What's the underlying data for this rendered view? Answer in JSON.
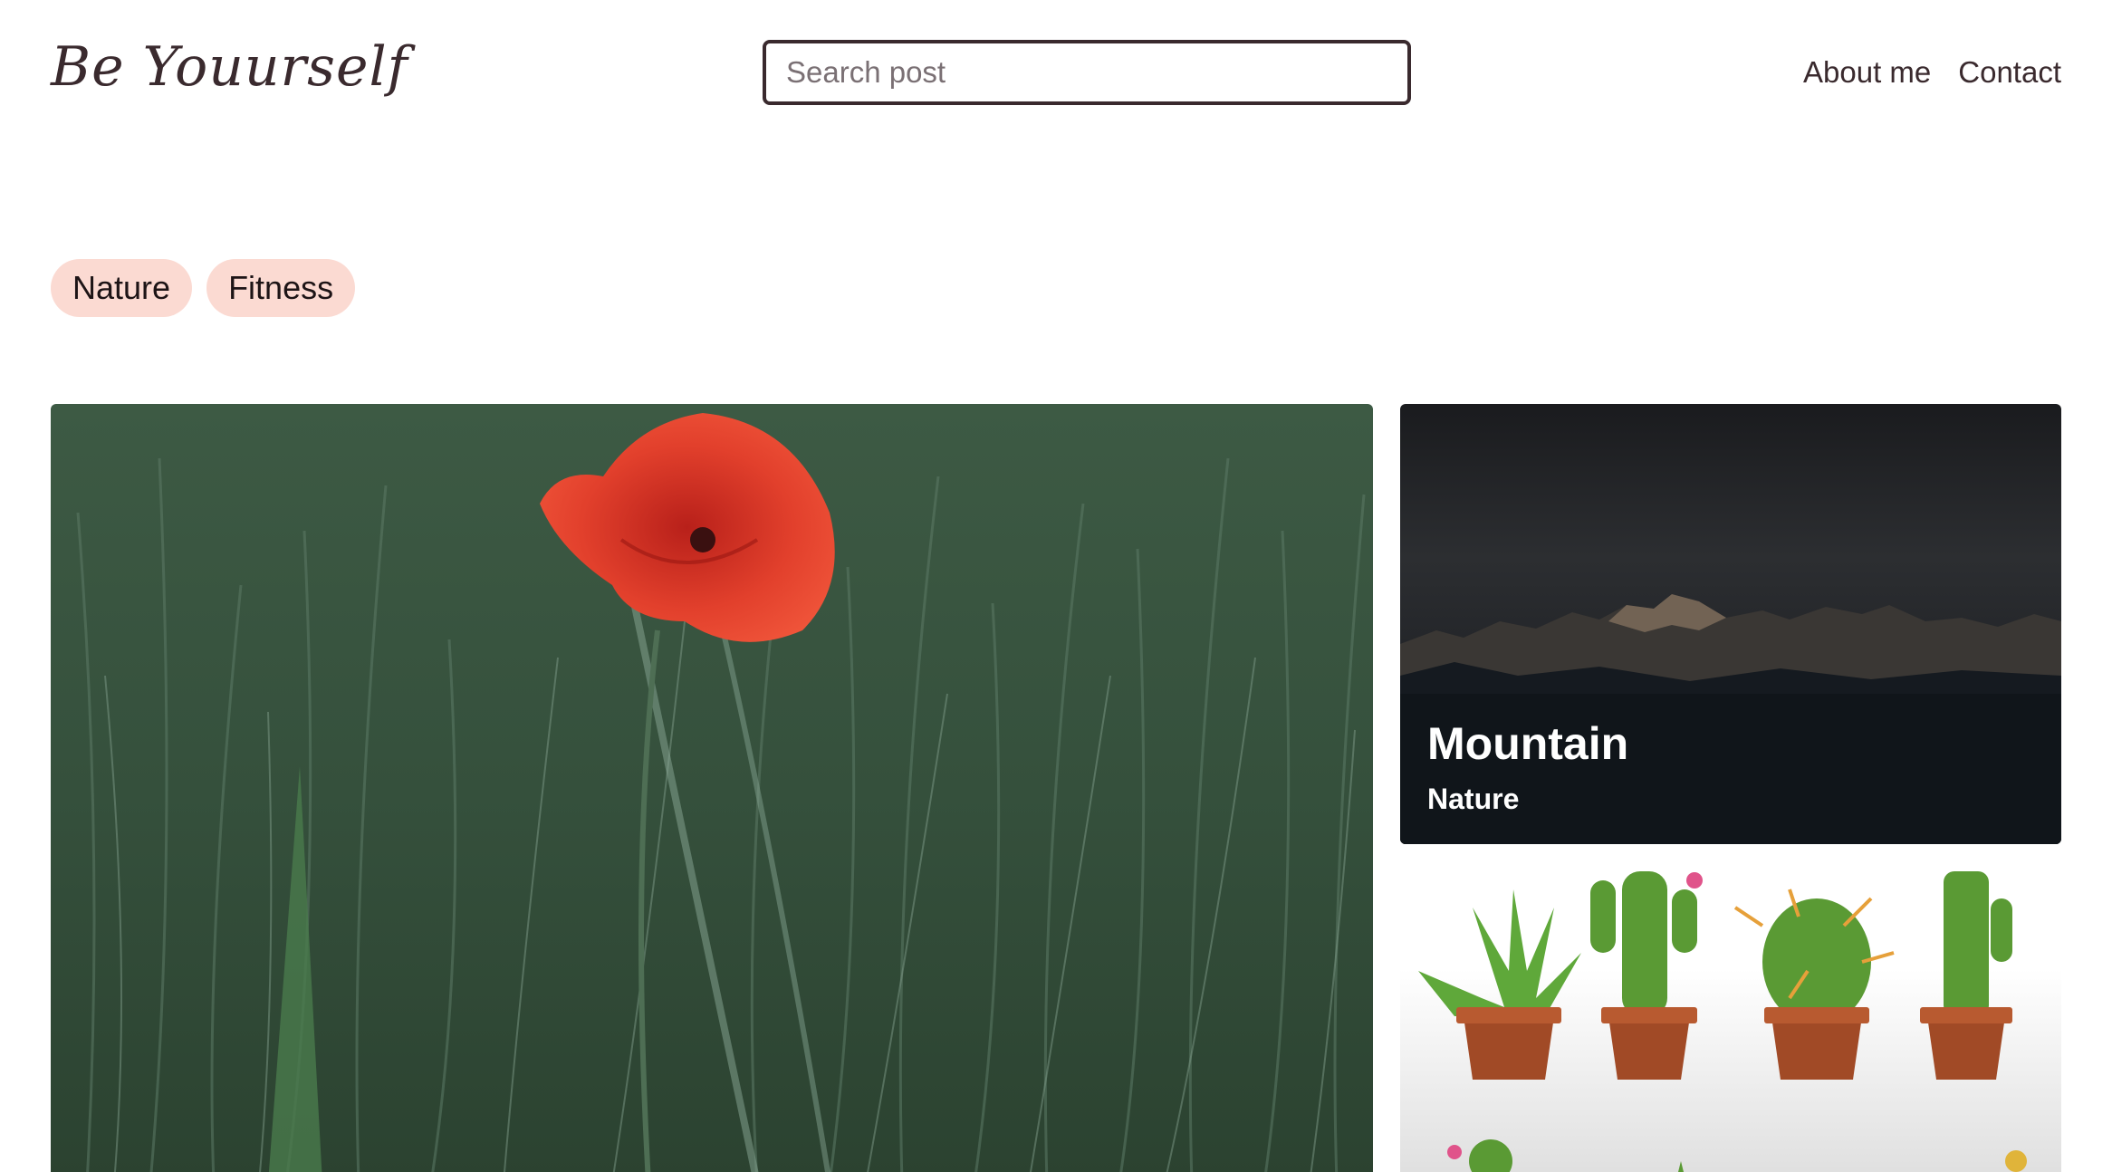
{
  "header": {
    "logo": "Be Youurself",
    "search": {
      "placeholder": "Search post",
      "value": ""
    },
    "nav": [
      {
        "label": "About me"
      },
      {
        "label": "Contact"
      }
    ]
  },
  "tags": [
    {
      "label": "Nature"
    },
    {
      "label": "Fitness"
    }
  ],
  "posts": [
    {
      "image": "red-poppy-in-grass",
      "title": "",
      "category": ""
    },
    {
      "image": "dark-mountain-range",
      "title": "Mountain",
      "category": "Nature"
    },
    {
      "image": "potted-cactus-illustration",
      "title": "",
      "category": ""
    }
  ],
  "colors": {
    "text": "#3a2a2e",
    "tag_background": "#fbdad2",
    "search_border": "#3a2a2e"
  }
}
